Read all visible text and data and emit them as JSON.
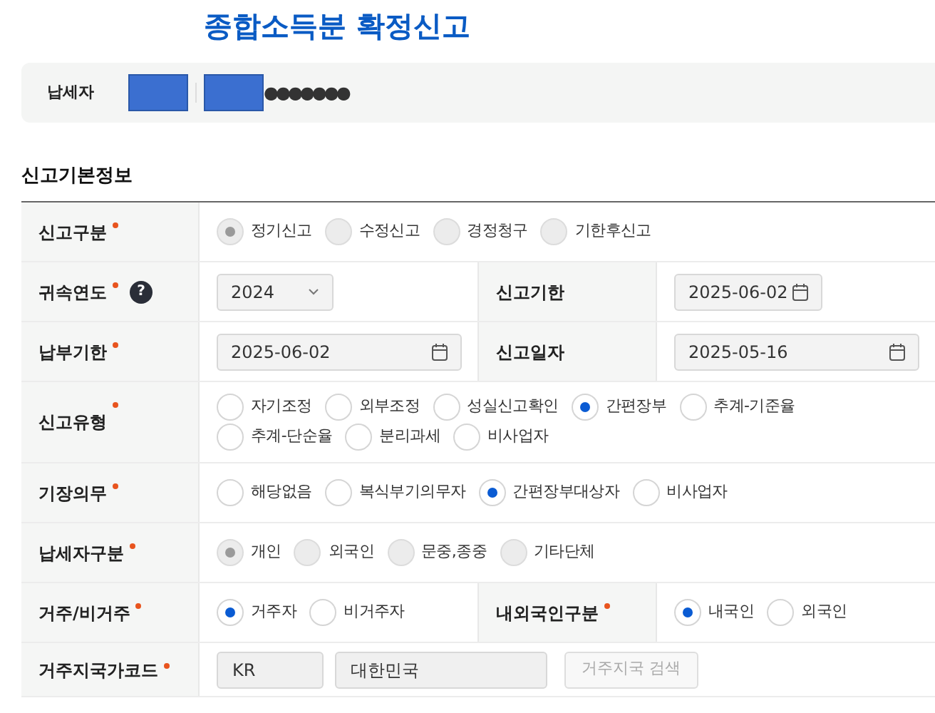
{
  "title": "종합소득분 확정신고",
  "taxpayer": {
    "label": "납세자",
    "masked": "●●●●●●●"
  },
  "section": {
    "title": "신고기본정보"
  },
  "rows": [
    {
      "kind": "radio",
      "label": "신고구분",
      "required": true,
      "disabled": true,
      "options": [
        {
          "label": "정기신고",
          "selected": true
        },
        {
          "label": "수정신고",
          "selected": false
        },
        {
          "label": "경정청구",
          "selected": false
        },
        {
          "label": "기한후신고",
          "selected": false
        }
      ]
    },
    {
      "kind": "pair",
      "cells": [
        {
          "label": "귀속연도",
          "required": true,
          "help": "?",
          "field": {
            "kind": "select",
            "value": "2024"
          }
        },
        {
          "label": "신고기한",
          "required": false,
          "field": {
            "kind": "date",
            "value": "2025-06-02"
          }
        }
      ]
    },
    {
      "kind": "pair",
      "cells": [
        {
          "label": "납부기한",
          "required": true,
          "field": {
            "kind": "date",
            "value": "2025-06-02"
          }
        },
        {
          "label": "신고일자",
          "required": false,
          "field": {
            "kind": "date",
            "value": "2025-05-16"
          }
        }
      ]
    },
    {
      "kind": "radio",
      "label": "신고유형",
      "required": true,
      "disabled": false,
      "options": [
        {
          "label": "자기조정",
          "selected": false
        },
        {
          "label": "외부조정",
          "selected": false
        },
        {
          "label": "성실신고확인",
          "selected": false
        },
        {
          "label": "간편장부",
          "selected": true
        },
        {
          "label": "추계-기준율",
          "selected": false
        },
        {
          "label": "추계-단순율",
          "selected": false
        },
        {
          "label": "분리과세",
          "selected": false
        },
        {
          "label": "비사업자",
          "selected": false
        }
      ]
    },
    {
      "kind": "radio",
      "label": "기장의무",
      "required": true,
      "disabled": false,
      "options": [
        {
          "label": "해당없음",
          "selected": false
        },
        {
          "label": "복식부기의무자",
          "selected": false
        },
        {
          "label": "간편장부대상자",
          "selected": true
        },
        {
          "label": "비사업자",
          "selected": false
        }
      ]
    },
    {
      "kind": "radio",
      "label": "납세자구분",
      "required": true,
      "disabled": true,
      "options": [
        {
          "label": "개인",
          "selected": true
        },
        {
          "label": "외국인",
          "selected": false
        },
        {
          "label": "문중,종중",
          "selected": false
        },
        {
          "label": "기타단체",
          "selected": false
        }
      ]
    },
    {
      "kind": "pair",
      "cells": [
        {
          "label": "거주/비거주",
          "required": true,
          "field": {
            "kind": "radio",
            "disabled": false,
            "options": [
              {
                "label": "거주자",
                "selected": true
              },
              {
                "label": "비거주자",
                "selected": false
              }
            ]
          }
        },
        {
          "label": "내외국인구분",
          "required": true,
          "field": {
            "kind": "radio",
            "disabled": false,
            "options": [
              {
                "label": "내국인",
                "selected": true
              },
              {
                "label": "외국인",
                "selected": false
              }
            ]
          }
        }
      ]
    },
    {
      "kind": "country",
      "label": "거주지국가코드",
      "required": true,
      "code": "KR",
      "name": "대한민국",
      "button": "거주지국 검색"
    }
  ]
}
